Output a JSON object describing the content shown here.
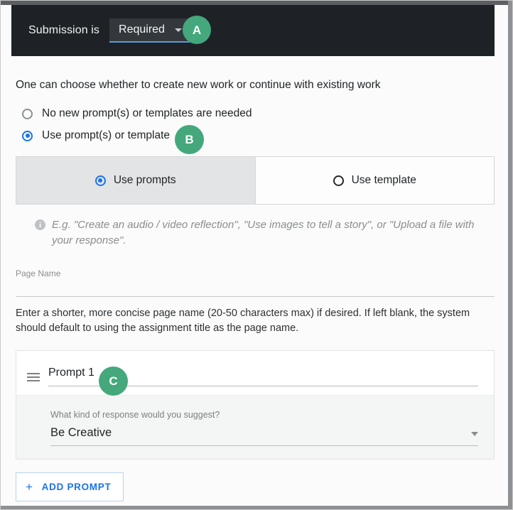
{
  "colors": {
    "badge_green": "#44a87c",
    "accent_blue": "#1a73e8",
    "header_bg": "#1e2226",
    "underline_blue": "#5b9bd5"
  },
  "header": {
    "label": "Submission is",
    "select_value": "Required",
    "caret_icon": "chevron-down-icon",
    "badge": "A"
  },
  "main": {
    "intro": "One can choose whether to create new work or continue with existing work",
    "options": [
      {
        "label": "No new prompt(s) or templates are needed",
        "selected": false
      },
      {
        "label": "Use prompt(s) or template",
        "selected": true,
        "badge": "B"
      }
    ],
    "segmented": [
      {
        "label": "Use prompts",
        "selected": true
      },
      {
        "label": "Use template",
        "selected": false
      }
    ],
    "note": {
      "icon": "info-icon",
      "text": "E.g. \"Create an audio / video reflection\", \"Use images to tell a story\", or \"Upload a file with your response\"."
    },
    "page_name": {
      "label": "Page Name",
      "value": "",
      "help": "Enter a shorter, more concise page name (20-50 characters max) if desired. If left blank, the system should default to using the assignment title as the page name."
    },
    "prompt": {
      "drag_icon": "drag-handle-icon",
      "title": "Prompt 1",
      "badge": "C",
      "response_label": "What kind of response would you suggest?",
      "response_value": "Be Creative",
      "response_caret": "chevron-down-icon"
    },
    "add_prompt": {
      "plus_icon": "plus-icon",
      "label": "ADD PROMPT"
    }
  }
}
